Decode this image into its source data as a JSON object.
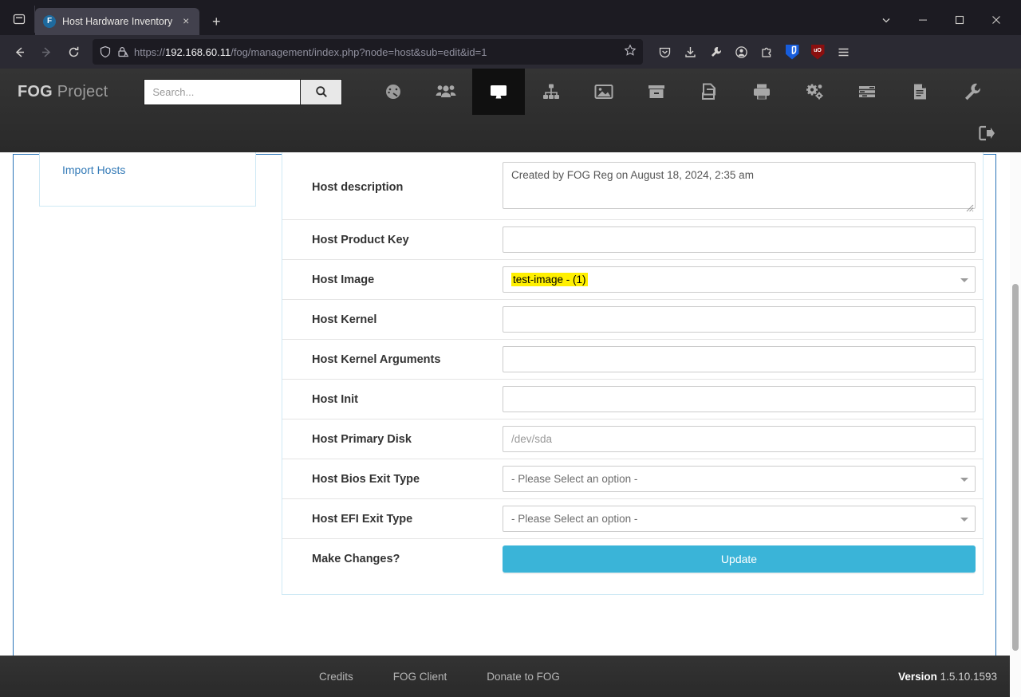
{
  "browser": {
    "tab": {
      "title": "Host Hardware Inventory",
      "favicon_letter": "F",
      "close_label": "×"
    },
    "new_tab_label": "+",
    "window_controls": {
      "tab_list": "chevron-down",
      "minimize": "–",
      "maximize": "□",
      "close": "✕"
    },
    "url": "https://192.168.60.11/fog/management/index.php?node=host&sub=edit&id=1",
    "url_host": "192.168.60.11",
    "url_scheme": "https://",
    "url_path": "/fog/management/index.php?node=host&sub=edit&id=1",
    "toolbar_icons": [
      "pocket-save-icon",
      "download-icon",
      "wrench-icon",
      "account-icon",
      "extensions-puzzle-icon",
      "bitwarden-extension-icon",
      "ublock-origin-extension-icon",
      "app-menu-icon"
    ],
    "ublock_label": "uO",
    "nav_icons": {
      "back": "back-arrow-icon",
      "forward": "forward-arrow-icon",
      "reload": "reload-icon"
    }
  },
  "fog": {
    "brand_bold": "FOG",
    "brand_rest": " Project",
    "search": {
      "placeholder": "Search...",
      "value": "",
      "button_icon": "search-icon"
    },
    "nav": [
      {
        "name": "dashboard",
        "icon": "dashboard-gauge-icon",
        "active": false
      },
      {
        "name": "users",
        "icon": "users-group-icon",
        "active": false
      },
      {
        "name": "hosts",
        "icon": "desktop-monitor-icon",
        "active": true
      },
      {
        "name": "groups",
        "icon": "sitemap-icon",
        "active": false
      },
      {
        "name": "images",
        "icon": "image-picture-icon",
        "active": false
      },
      {
        "name": "storage",
        "icon": "storage-box-icon",
        "active": false
      },
      {
        "name": "snapins",
        "icon": "clone-copy-icon",
        "active": false
      },
      {
        "name": "printers",
        "icon": "printer-icon",
        "active": false
      },
      {
        "name": "services",
        "icon": "gears-icon",
        "active": false
      },
      {
        "name": "tasks",
        "icon": "task-list-icon",
        "active": false
      },
      {
        "name": "reports",
        "icon": "document-report-icon",
        "active": false
      },
      {
        "name": "configuration",
        "icon": "wrench-icon",
        "active": false
      }
    ],
    "logout_icon": "logout-sign-out-icon"
  },
  "sidebar": {
    "items": [
      {
        "label": "Import Hosts"
      }
    ]
  },
  "form": {
    "rows": [
      {
        "label": "Host description",
        "type": "textarea",
        "value": "Created by FOG Reg on August 18, 2024, 2:35 am",
        "placeholder": ""
      },
      {
        "label": "Host Product Key",
        "type": "text",
        "value": "",
        "placeholder": ""
      },
      {
        "label": "Host Image",
        "type": "select",
        "value": "test-image - (1)",
        "highlighted": true
      },
      {
        "label": "Host Kernel",
        "type": "text",
        "value": "",
        "placeholder": ""
      },
      {
        "label": "Host Kernel Arguments",
        "type": "text",
        "value": "",
        "placeholder": ""
      },
      {
        "label": "Host Init",
        "type": "text",
        "value": "",
        "placeholder": ""
      },
      {
        "label": "Host Primary Disk",
        "type": "text",
        "value": "",
        "placeholder": "/dev/sda"
      },
      {
        "label": "Host Bios Exit Type",
        "type": "select",
        "value": "- Please Select an option -",
        "highlighted": false
      },
      {
        "label": "Host EFI Exit Type",
        "type": "select",
        "value": "- Please Select an option -",
        "highlighted": false
      },
      {
        "label": "Make Changes?",
        "type": "button",
        "value": "Update"
      }
    ]
  },
  "footer": {
    "links": [
      "Credits",
      "FOG Client",
      "Donate to FOG"
    ],
    "version_label": "Version",
    "version_value": "1.5.10.1593"
  },
  "colors": {
    "accent_blue": "#3ab4d8",
    "link_blue": "#337ab7",
    "highlight_yellow": "#fff000",
    "frame_border": "#2a74b8",
    "panel_border": "#cfe9f5",
    "header_bg": "#2e2e2e"
  }
}
